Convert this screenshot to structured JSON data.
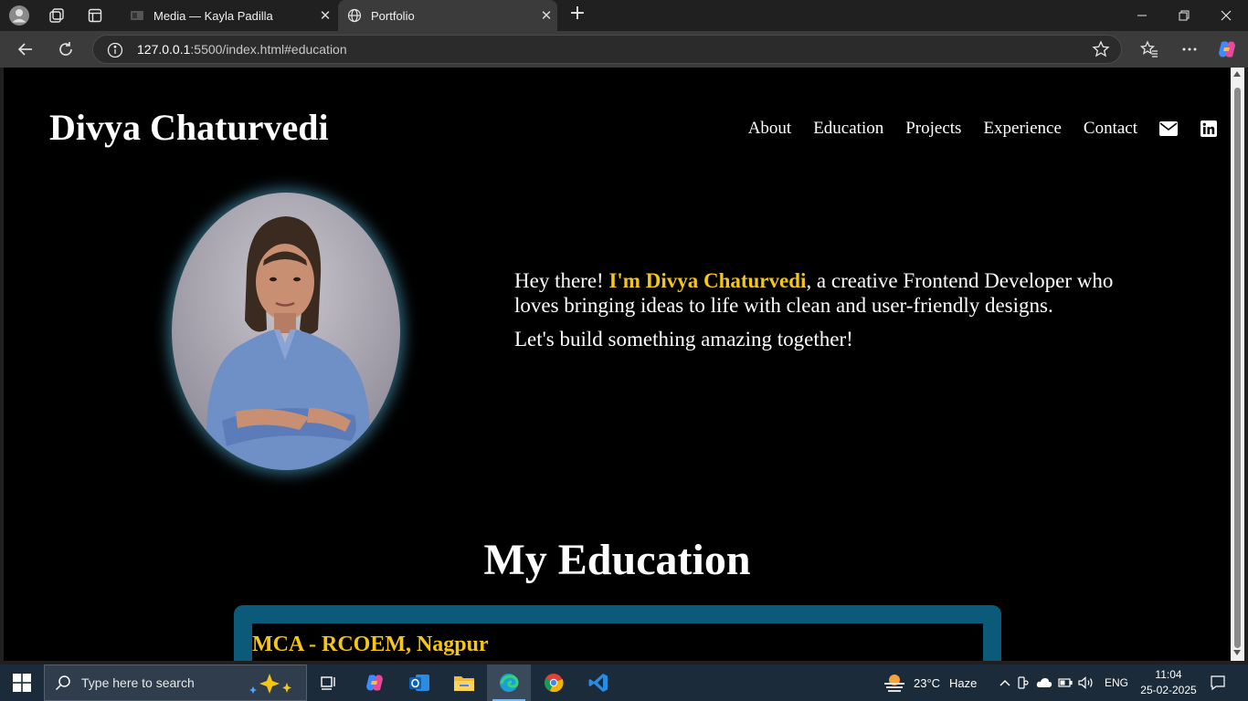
{
  "browser": {
    "tabs": [
      {
        "title": "Media — Kayla Padilla",
        "active": false
      },
      {
        "title": "Portfolio",
        "active": true
      }
    ],
    "url_host": "127.0.0.1",
    "url_rest": ":5500/index.html#education"
  },
  "site": {
    "logo": "Divya Chaturvedi",
    "nav": [
      "About",
      "Education",
      "Projects",
      "Experience",
      "Contact"
    ],
    "intro": {
      "greeting": "Hey there! ",
      "name": "I'm Divya Chaturvedi",
      "rest": ", a creative Frontend Developer who loves bringing ideas to life with clean and user-friendly designs.",
      "cta": "Let's build something amazing together!"
    },
    "education": {
      "title": "My Education",
      "items": [
        {
          "degree": "MCA - RCOEM, Nagpur"
        }
      ]
    },
    "colors": {
      "accent": "#f5c518",
      "card": "#0b5a7a",
      "background": "#000000"
    }
  },
  "taskbar": {
    "search_placeholder": "Type here to search",
    "weather": {
      "temp": "23°C",
      "condition": "Haze"
    },
    "language": "ENG",
    "time": "11:04",
    "date": "25-02-2025"
  }
}
